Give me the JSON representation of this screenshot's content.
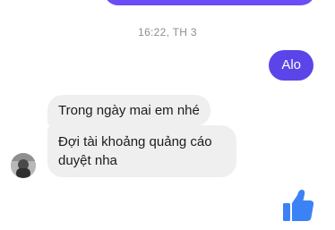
{
  "conversation": {
    "timestamp": "16:22, TH 3",
    "outgoing_message": "Alo",
    "incoming_messages": [
      "Trong ngày mai em nhé",
      "Đợi tài khoảng quảng cáo duyệt nha"
    ]
  },
  "icons": {
    "reaction": "thumbs-up-icon"
  },
  "colors": {
    "outgoing_bubble": "#5b45e8",
    "incoming_bubble": "#efefef",
    "like_icon": "#3b82f6",
    "timestamp": "#8e8e93"
  }
}
